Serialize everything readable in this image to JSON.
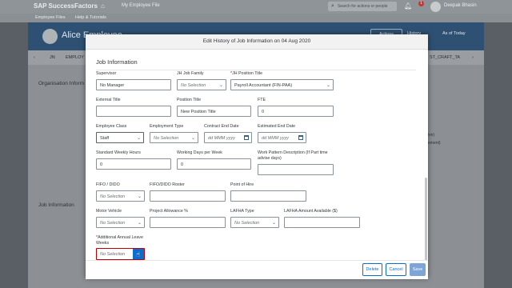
{
  "app": {
    "logo": "SAP SuccessFactors",
    "nav_label": "My Employee File",
    "search_placeholder": "Search for actions or people",
    "notification_count": "1",
    "user_name": "Deepak Bhasin",
    "subnav": [
      "Employee Files",
      "Help & Tutorials"
    ]
  },
  "profile": {
    "name": "Alice Employee",
    "actions_label": "Actions",
    "history_label": "History",
    "as_of_label": "As of Today",
    "tabs": [
      "JN",
      "EMPLOY",
      "ST_CRAFT_TA"
    ],
    "sections": [
      "Organisation Inform",
      "Job Information"
    ],
    "side_fragments": [
      "ive)",
      "ement)"
    ]
  },
  "dialog": {
    "title": "Edit History of Job Information on 04 Aug 2020",
    "section_title": "Job Information",
    "fields": {
      "supervisor": {
        "label": "Supervisor",
        "value": "No Manager"
      },
      "jh_job_family": {
        "label": "JH Job Family",
        "placeholder": "No Selection"
      },
      "jh_position_title": {
        "label": "JH Position Title",
        "required_mark": "*",
        "value": "Payroll Accountant (FIN-PAA)"
      },
      "external_title": {
        "label": "External Title",
        "value": ""
      },
      "position_title": {
        "label": "Position Title",
        "value": "New Position Title"
      },
      "fte": {
        "label": "FTE",
        "value": "0"
      },
      "employee_class": {
        "label": "Employee Class",
        "value": "Staff"
      },
      "employment_type": {
        "label": "Employment Type",
        "placeholder": "No Selection"
      },
      "contract_end_date": {
        "label": "Contract End Date",
        "placeholder": "dd MMM yyyy"
      },
      "estimated_end_date": {
        "label": "Estimated End Date",
        "placeholder": "dd MMM yyyy"
      },
      "standard_weekly_hours": {
        "label": "Standard Weekly Hours",
        "value": "0"
      },
      "working_days_per_week": {
        "label": "Working Days per Week",
        "value": "0"
      },
      "work_pattern_description": {
        "label": "Work Pattern Description (If Part time advise days)",
        "value": ""
      },
      "fifo_dido": {
        "label": "FIFO / DIDO",
        "placeholder": "No Selection"
      },
      "fifo_dido_roster": {
        "label": "FIFO/DIDO Roster",
        "value": ""
      },
      "point_of_hire": {
        "label": "Point of Hire",
        "value": ""
      },
      "motor_vehicle": {
        "label": "Motor Vehicle",
        "placeholder": "No Selection"
      },
      "project_allowance": {
        "label": "Project Allowance %",
        "value": ""
      },
      "lafha_type": {
        "label": "LAFHA Type",
        "placeholder": "No Selection"
      },
      "lafha_amount": {
        "label": "LAFHA Amount Available ($)",
        "value": ""
      },
      "additional_annual_leave": {
        "label": "Additional Annual Leave Weeks",
        "required_mark": "*",
        "placeholder": "No Selection"
      }
    },
    "buttons": {
      "delete": "Delete",
      "cancel": "Cancel",
      "save": "Save"
    }
  },
  "colors": {
    "accent": "#0a6ed1",
    "required": "#bb0000",
    "header": "#2e5072"
  },
  "icons": [
    "home-icon",
    "search-icon",
    "bell-icon",
    "chevron-down-icon",
    "calendar-icon",
    "cursor-icon"
  ]
}
